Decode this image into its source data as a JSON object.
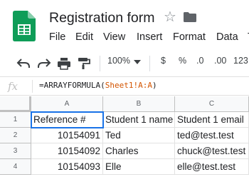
{
  "app": {
    "doc_title": "Registration form",
    "menu": [
      "File",
      "Edit",
      "View",
      "Insert",
      "Format",
      "Data",
      "T"
    ]
  },
  "toolbar": {
    "zoom": "100%",
    "currency": "$",
    "percent": "%",
    "decrease_decimals": ".0",
    "increase_decimals": ".00",
    "number_format": "123"
  },
  "formula_bar": {
    "fx_label": "fx",
    "formula_prefix": "=ARRAYFORMULA(",
    "formula_ref": "Sheet1!A:A",
    "formula_suffix": ")"
  },
  "sheet": {
    "columns": [
      "A",
      "B",
      "C"
    ],
    "rows": [
      "1",
      "2",
      "3",
      "4"
    ],
    "cells": [
      [
        "Reference #",
        "Student 1 name",
        "Student 1 email"
      ],
      [
        "10154091",
        "Ted",
        "ted@test.test"
      ],
      [
        "10154092",
        "Charles",
        "chuck@test.test"
      ],
      [
        "10154093",
        "Elle",
        "elle@test.test"
      ]
    ]
  },
  "colors": {
    "sheets_green": "#0f9d58",
    "selection_blue": "#1a73e8",
    "formula_ref": "#d35400"
  }
}
